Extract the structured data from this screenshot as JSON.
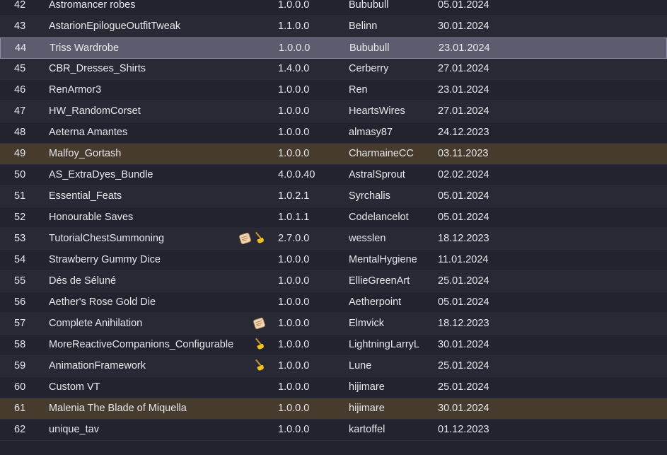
{
  "mods": [
    {
      "index": "42",
      "name": "Astromancer robes",
      "icons": [],
      "version": "1.0.0.0",
      "author": "Bububull",
      "date": "05.01.2024",
      "state": "normal"
    },
    {
      "index": "43",
      "name": "AstarionEpilogueOutfitTweak",
      "icons": [],
      "version": "1.1.0.0",
      "author": "Belinn",
      "date": "30.01.2024",
      "state": "alt"
    },
    {
      "index": "44",
      "name": "Triss Wardrobe",
      "icons": [],
      "version": "1.0.0.0",
      "author": "Bububull",
      "date": "23.01.2024",
      "state": "selected"
    },
    {
      "index": "45",
      "name": "CBR_Dresses_Shirts",
      "icons": [],
      "version": "1.4.0.0",
      "author": "Cerberry",
      "date": "27.01.2024",
      "state": "alt"
    },
    {
      "index": "46",
      "name": "RenArmor3",
      "icons": [],
      "version": "1.0.0.0",
      "author": "Ren",
      "date": "23.01.2024",
      "state": "normal"
    },
    {
      "index": "47",
      "name": "HW_RandomCorset",
      "icons": [],
      "version": "1.0.0.0",
      "author": "HeartsWires",
      "date": "27.01.2024",
      "state": "alt"
    },
    {
      "index": "48",
      "name": "Aeterna Amantes",
      "icons": [],
      "version": "1.0.0.0",
      "author": "almasy87",
      "date": "24.12.2023",
      "state": "normal"
    },
    {
      "index": "49",
      "name": "Malfoy_Gortash",
      "icons": [],
      "version": "1.0.0.0",
      "author": "CharmaineCC",
      "date": "03.11.2023",
      "state": "highlight"
    },
    {
      "index": "50",
      "name": "AS_ExtraDyes_Bundle",
      "icons": [],
      "version": "4.0.0.40",
      "author": "AstralSprout",
      "date": "02.02.2024",
      "state": "normal"
    },
    {
      "index": "51",
      "name": "Essential_Feats",
      "icons": [],
      "version": "1.0.2.1",
      "author": "Syrchalis",
      "date": "05.01.2024",
      "state": "alt"
    },
    {
      "index": "52",
      "name": "Honourable Saves",
      "icons": [],
      "version": "1.0.1.1",
      "author": "Codelancelot",
      "date": "05.01.2024",
      "state": "normal"
    },
    {
      "index": "53",
      "name": "TutorialChestSummoning",
      "icons": [
        "scroll-icon",
        "broom-icon"
      ],
      "version": "2.7.0.0",
      "author": "wesslen",
      "date": "18.12.2023",
      "state": "alt"
    },
    {
      "index": "54",
      "name": "Strawberry Gummy Dice",
      "icons": [],
      "version": "1.0.0.0",
      "author": " MentalHygiene",
      "date": "11.01.2024",
      "state": "normal"
    },
    {
      "index": "55",
      "name": "Dés de Séluné",
      "icons": [],
      "version": "1.0.0.0",
      "author": "EllieGreenArt",
      "date": "25.01.2024",
      "state": "alt"
    },
    {
      "index": "56",
      "name": "Aether's Rose Gold Die",
      "icons": [],
      "version": "1.0.0.0",
      "author": "Aetherpoint",
      "date": "05.01.2024",
      "state": "normal"
    },
    {
      "index": "57",
      "name": "Complete Anihilation",
      "icons": [
        "scroll-icon"
      ],
      "version": "1.0.0.0",
      "author": "Elmvick",
      "date": "18.12.2023",
      "state": "alt"
    },
    {
      "index": "58",
      "name": "MoreReactiveCompanions_Configurable",
      "icons": [
        "broom-icon"
      ],
      "version": "1.0.0.0",
      "author": "LightningLarryL",
      "date": "30.01.2024",
      "state": "normal"
    },
    {
      "index": "59",
      "name": "AnimationFramework",
      "icons": [
        "broom-icon"
      ],
      "version": "1.0.0.0",
      "author": "Lune",
      "date": "25.01.2024",
      "state": "alt"
    },
    {
      "index": "60",
      "name": "Custom VT",
      "icons": [],
      "version": "1.0.0.0",
      "author": "hijimare",
      "date": "25.01.2024",
      "state": "normal"
    },
    {
      "index": "61",
      "name": "Malenia The Blade of Miquella",
      "icons": [],
      "version": "1.0.0.0",
      "author": "hijimare",
      "date": "30.01.2024",
      "state": "highlight"
    },
    {
      "index": "62",
      "name": "unique_tav",
      "icons": [],
      "version": "1.0.0.0",
      "author": "kartoffel",
      "date": "01.12.2023",
      "state": "normal"
    }
  ]
}
